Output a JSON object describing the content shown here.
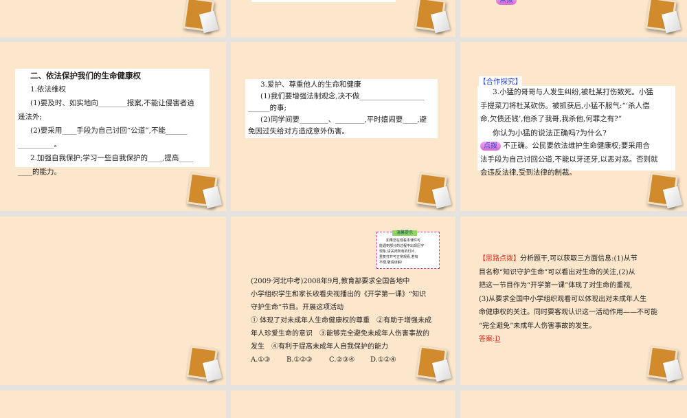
{
  "slide3_badge": "点拨",
  "slide4": {
    "title": "二、依法保护我们的生命健康权",
    "lines": [
      "1.依法维权",
      "(1)要及时、如实地向________报案,不能让侵害者逍",
      "遥法外;",
      "(2)要采用____手段为自己讨回“公道”,不能______",
      "__________。",
      "2.加强自我保护;学习一些自我保护的____,提高____",
      "____的能力。"
    ]
  },
  "slide5": {
    "lines": [
      "3.爱护、尊重他人的生命和健康",
      "(1)我们要增强法制观念,决不做__________________",
      "______的事;",
      "(2)同学间要________、________,平时嬉闹要____,避",
      "免因过失给对方造成意外伤害。"
    ]
  },
  "slide6": {
    "header": "【合作探究】",
    "lines": [
      "3.小猛的哥哥与人发生纠纷,被杜某打伤致死。小猛",
      "手提菜刀将杜某砍伤。被抓获后,小猛不服气:“‘杀人偿",
      "命,欠债还钱’,他杀了我哥,我杀他,何罪之有?”",
      "你认为小猛的说法正确吗?为什么?"
    ],
    "badge": "点拨",
    "answer_lines": [
      "不正确。公民要依法维护生命健康权;要采用合",
      "法手段为自己讨回公道,不能以牙还牙,以恶对恶。否则就",
      "会违反法律,受到法律的制裁。"
    ]
  },
  "slide8": {
    "tip_title": "温馨提示",
    "tip_lines": [
      "如果您在观看本课件可",
      "能遇到部分的过程中出现压字",
      "现象,请关闭所有的灯片,",
      "重复打开可正常观看,若有",
      "不便,敬请谅解!"
    ],
    "lines": [
      "(2009·河北中考)2008年9月,教育部要求全国各地中",
      "小学组织学生和家长收看央视播出的《开学第一课》“知识",
      "守护生命”节目。开展这项活动",
      "① 体现了对未成年人生命健康权的尊重　②有助于增强未成",
      "年人珍爱生命的意识　③能够完全避免未成年人伤害事故的",
      "发生　④有利于提高未成年人自我保护的能力"
    ],
    "options": [
      "A.①③",
      "B.①②③",
      "C.②③④",
      "D.①②④"
    ]
  },
  "slide9": {
    "header": "【思路点拨】",
    "lines": [
      "分析题干,可以获取三方面信息:(1)从节",
      "目名称“知识守护生命”可以看出对生命的关注,(2)从",
      "把这一节目作为“开学第一课”体现了对生命的重视,",
      "(3)从要求全国中小学组织观看可以体现出对未成年人生",
      "命健康权的关注。同时要客观认识这一活动作用——不可能",
      "“完全避免”未成年人伤害事故的发生。"
    ],
    "answer_label": "答案:",
    "answer": "D"
  }
}
